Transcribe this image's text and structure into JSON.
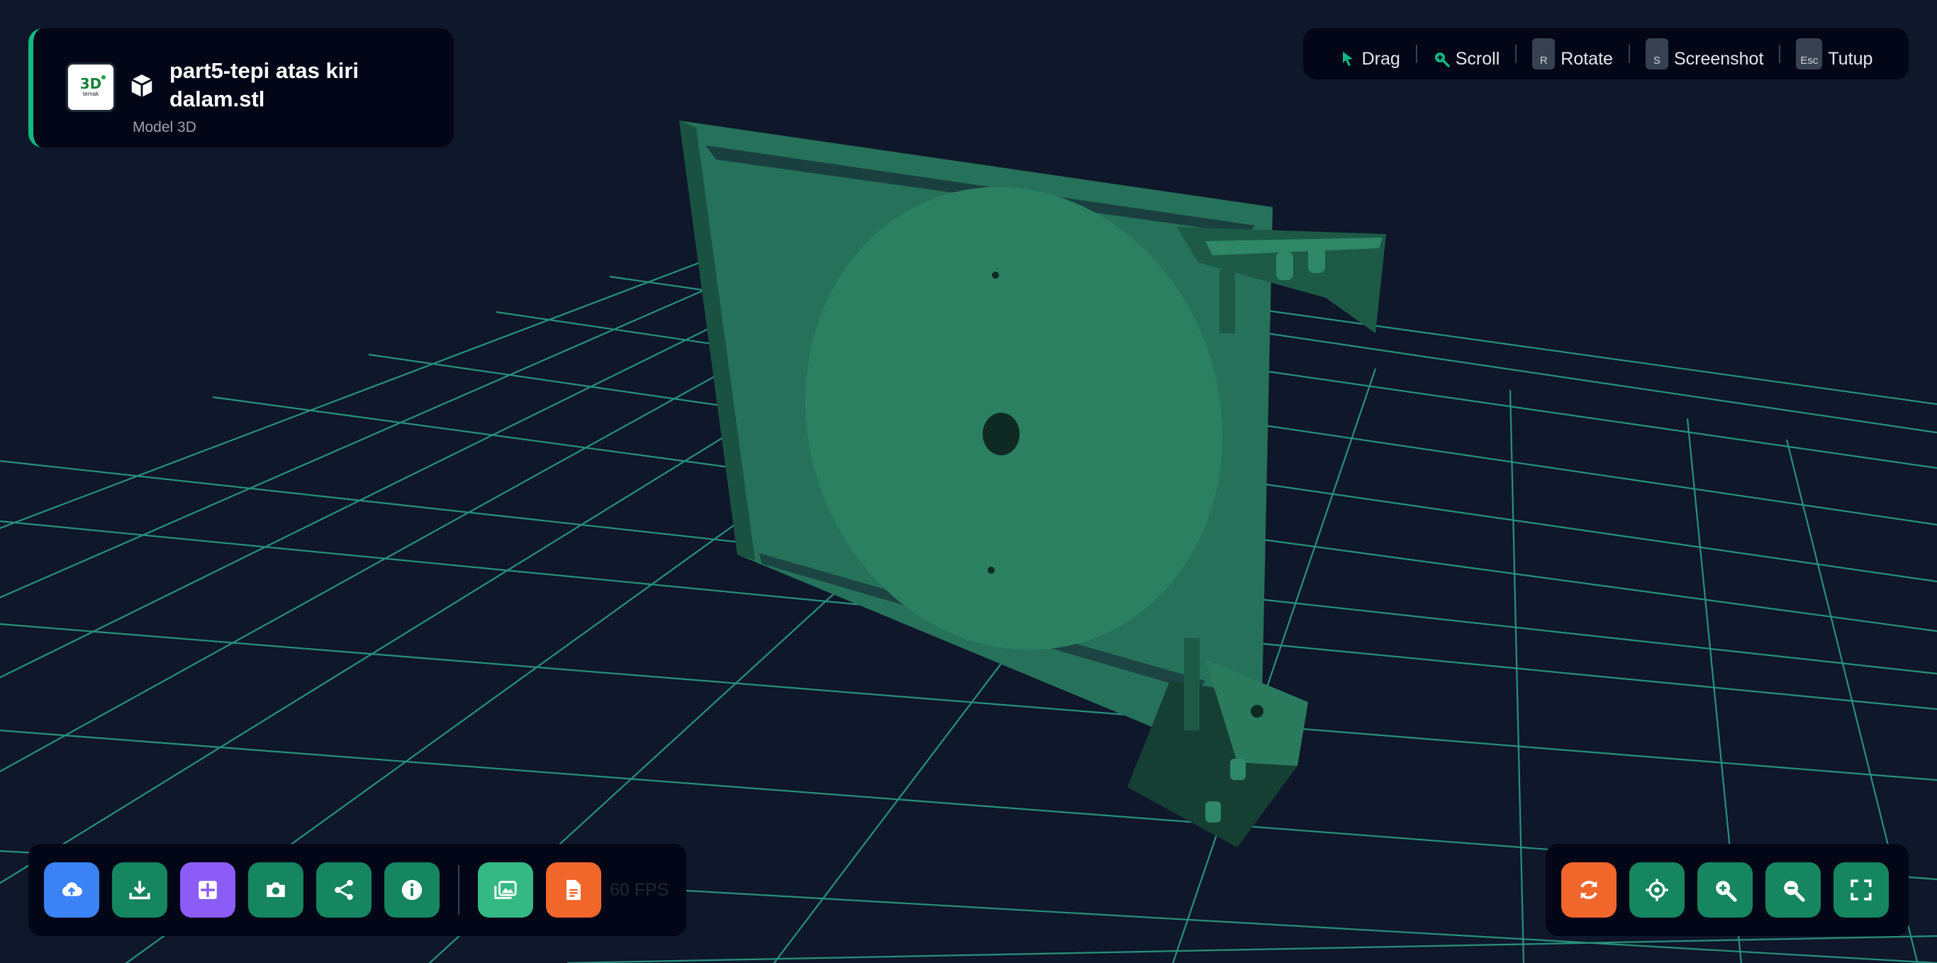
{
  "file": {
    "name": "part5-tepi atas kiri dalam.stl",
    "type_label": "Model 3D",
    "logo_text": "3D",
    "logo_subtext": "ternak"
  },
  "shortcuts": [
    {
      "icon": "cursor-icon",
      "key": "",
      "label": "Drag"
    },
    {
      "icon": "zoom-icon",
      "key": "",
      "label": "Scroll"
    },
    {
      "icon": "",
      "key": "R",
      "label": "Rotate"
    },
    {
      "icon": "",
      "key": "S",
      "label": "Screenshot"
    },
    {
      "icon": "",
      "key": "Esc",
      "label": "Tutup"
    }
  ],
  "toolbar_left": {
    "buttons": [
      "upload-icon",
      "download-icon",
      "grid-icon",
      "camera-icon",
      "share-icon",
      "info-icon",
      "gallery-icon",
      "document-icon"
    ],
    "trailing_text": "60 FPS"
  },
  "toolbar_right": {
    "buttons": [
      "refresh-icon",
      "target-icon",
      "zoom-in-icon",
      "zoom-out-icon",
      "fullscreen-icon"
    ]
  },
  "colors": {
    "background": "#0f172a",
    "grid": "#2dd4bf",
    "model": "#2a7a5e",
    "accent": "#10b981",
    "blue": "#3b82f6",
    "purple": "#8b5cf6",
    "orange": "#f0662b"
  }
}
